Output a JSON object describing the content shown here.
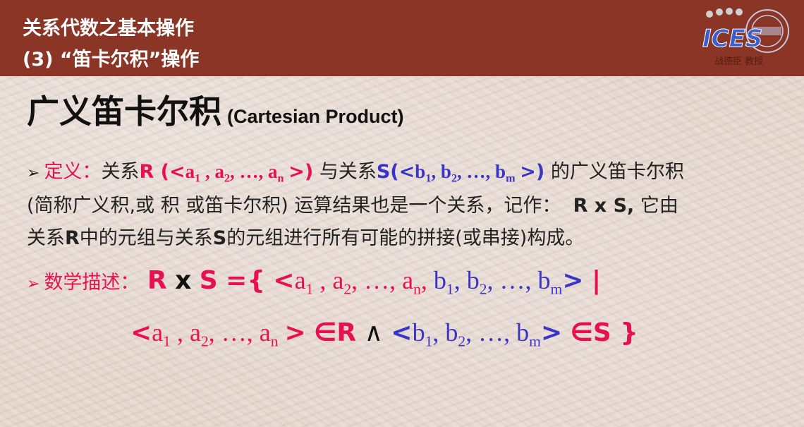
{
  "header": {
    "line1": "关系代数之基本操作",
    "line2": "(3) “笛卡尔积”操作",
    "logo_text": "ICES",
    "logo_caption": "战德臣 教授"
  },
  "title": {
    "cn": "广义笛卡尔积",
    "en": "(Cartesian Product)"
  },
  "definition": {
    "bullet": "➢",
    "label": "定义：",
    "t1": "关系",
    "R": "R (<",
    "t2": "与关系",
    "S": "S(<",
    "t3": "的广义笛卡尔积",
    "t4": "(简称广义积,或 积 或笛卡尔积) 运算结果也是一个关系，记作：",
    "rxs": "R x S,",
    "t5": "它由",
    "t6": "关系",
    "t6R": "R",
    "t7": "中的元组与关系",
    "t7S": "S",
    "t8": "的元组进行所有可能的拼接(或串接)构成。"
  },
  "math": {
    "bullet": "➢",
    "label": "数学描述：",
    "lhs_R": "R",
    "lhs_x": "x",
    "lhs_S": "S",
    "eq": "={",
    "open": "<",
    "a": "a",
    "sub1": "1",
    "sub2": "2",
    "subn": "n",
    "b": "b",
    "subm": "m",
    "ellipsis": "…",
    "close_bar": "> |",
    "close": ">",
    "in_R": "∈R",
    "wedge": "∧",
    "in_S": "∈S }",
    "open2": "<",
    "open3": "<"
  }
}
